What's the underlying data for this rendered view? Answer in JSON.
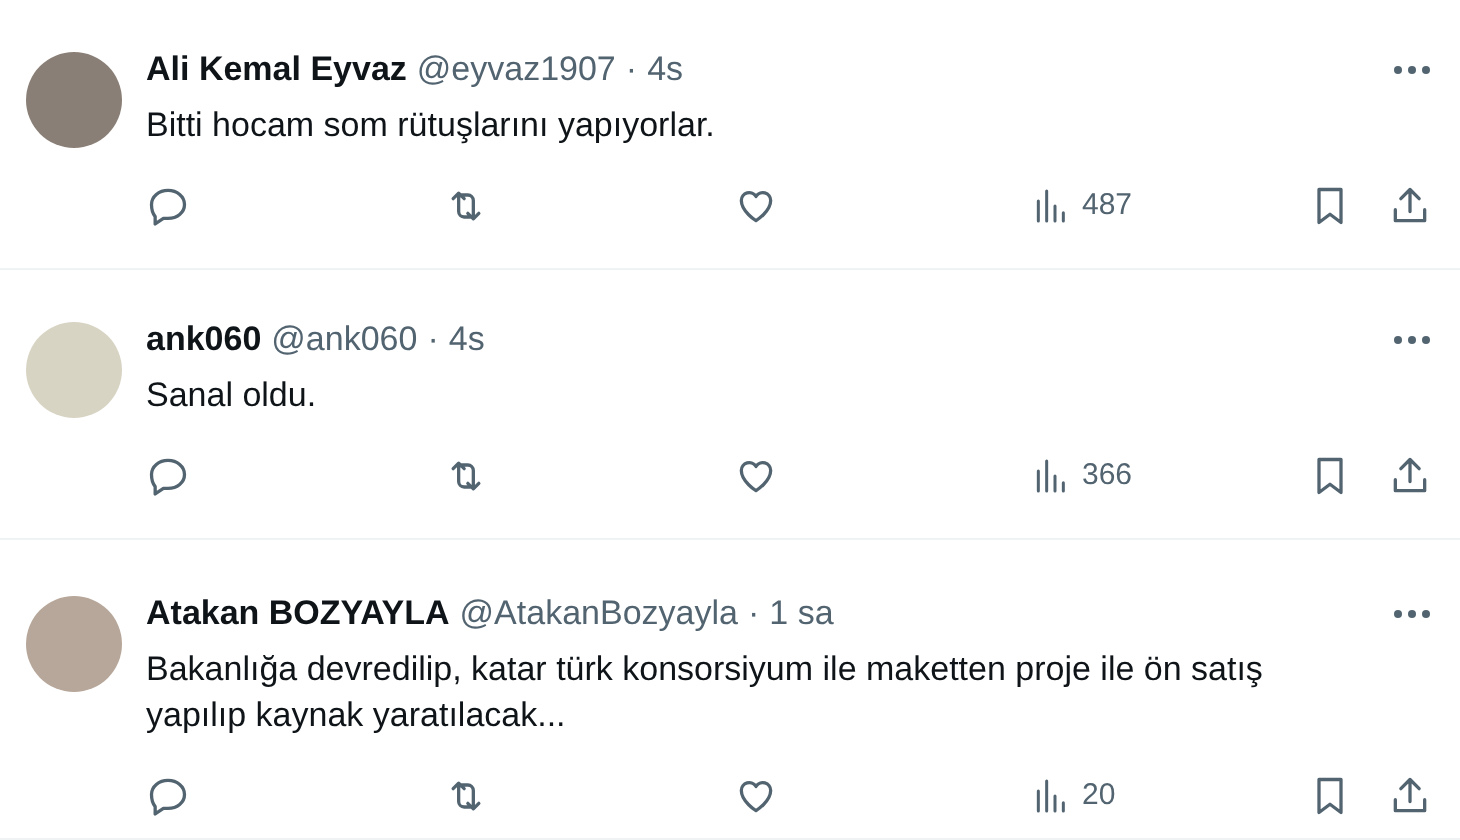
{
  "tweets": [
    {
      "name": "Ali Kemal Eyvaz",
      "handle": "@eyvaz1907",
      "separator": "·",
      "time": "4s",
      "text": "Bitti hocam som rütuşlarını yapıyorlar.",
      "views": "487"
    },
    {
      "name": "ank060",
      "handle": "@ank060",
      "separator": "·",
      "time": "4s",
      "text": "Sanal oldu.",
      "views": "366"
    },
    {
      "name": "Atakan BOZYAYLA",
      "handle": "@AtakanBozyayla",
      "separator": "·",
      "time": "1 sa",
      "text": "Bakanlığa devredilip, katar türk konsorsiyum ile maketten proje ile ön satış yapılıp kaynak yaratılacak...",
      "views": "20"
    }
  ]
}
